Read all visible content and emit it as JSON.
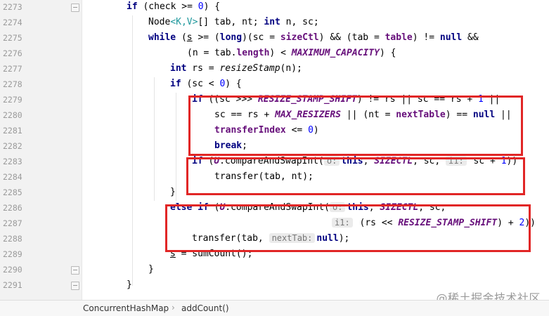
{
  "line_numbers": [
    "2273",
    "2274",
    "2275",
    "2276",
    "2277",
    "2278",
    "2279",
    "2280",
    "2281",
    "2282",
    "2283",
    "2284",
    "2285",
    "2286",
    "2287",
    "2288",
    "2289",
    "2290",
    "2291"
  ],
  "code": {
    "l2273": {
      "kw_if": "if",
      "rest": " (check >= ",
      "zero": "0",
      "close": ") {"
    },
    "l2274": {
      "node": "Node",
      "generic": "<K,V>",
      "arr": "[] tab, nt; ",
      "kw_int": "int",
      "rest": " n, sc;"
    },
    "l2275": {
      "kw_while": "while",
      "p1": " (",
      "s": "s",
      "p2": " >= (",
      "kw_long": "long",
      "p3": ")(sc = ",
      "sizectl": "sizeCtl",
      "p4": ") && (tab = ",
      "table": "table",
      "p5": ") != ",
      "kw_null": "null",
      "p6": " &&"
    },
    "l2276": {
      "p1": "(n = tab.",
      "length": "length",
      "p2": ") < ",
      "maxcap": "MAXIMUM_CAPACITY",
      "p3": ") {"
    },
    "l2277": {
      "kw_int": "int",
      "p1": " rs = ",
      "fn": "resizeStamp",
      "p2": "(n);"
    },
    "l2278": {
      "kw_if": "if",
      "p1": " (sc < ",
      "zero": "0",
      "p2": ") {"
    },
    "l2279": {
      "kw_if": "if",
      "p1": " ((sc >>> ",
      "shift": "RESIZE_STAMP_SHIFT",
      "p2": ") != rs || sc == rs + ",
      "one": "1",
      "p3": " ||"
    },
    "l2280": {
      "p1": "sc == rs + ",
      "maxres": "MAX_RESIZERS",
      "p2": " || (nt = ",
      "nexttable": "nextTable",
      "p3": ") == ",
      "kw_null": "null",
      "p4": " ||"
    },
    "l2281": {
      "transferindex": "transferIndex",
      "p1": " <= ",
      "zero": "0",
      "p2": ")"
    },
    "l2282": {
      "kw_break": "break",
      "p1": ";"
    },
    "l2283": {
      "kw_if": "if",
      "p1": " (",
      "u": "U",
      "p2": ".compareAndSwapInt(",
      "hint_o": "o:",
      "kw_this": "this",
      "p3": ", ",
      "sizectl_c": "SIZECTL",
      "p4": ", sc, ",
      "hint_i1": "i1:",
      "p5": " sc + ",
      "one": "1",
      "p6": "))"
    },
    "l2284": {
      "p1": "transfer(tab, nt);"
    },
    "l2285": {
      "p1": "}"
    },
    "l2286": {
      "kw_else": "else",
      "sp": " ",
      "kw_if": "if",
      "p1": " (",
      "u": "U",
      "p2": ".compareAndSwapInt(",
      "hint_o": "o:",
      "kw_this": "this",
      "p3": ", ",
      "sizectl_c": "SIZECTL",
      "p4": ", sc,"
    },
    "l2287": {
      "hint_i1": "i1:",
      "p1": " (rs << ",
      "shift": "RESIZE_STAMP_SHIFT",
      "p2": ") + ",
      "two": "2",
      "p3": "))"
    },
    "l2288": {
      "p1": "transfer(tab, ",
      "hint_next": "nextTab:",
      "kw_null": "null",
      "p2": ");"
    },
    "l2289": {
      "s": "s",
      "p1": " = sumCount();"
    },
    "l2290": {
      "p1": "}"
    },
    "l2291": {
      "p1": "}"
    }
  },
  "breadcrumb": {
    "class_name": "ConcurrentHashMap",
    "separator": "›",
    "method_name": "addCount()"
  },
  "watermark": "@稀土掘金技术社区",
  "colors": {
    "keyword": "#000080",
    "field": "#660e7a",
    "number": "#0000ff",
    "highlight_box": "#e12626",
    "gutter": "#f2f2f2"
  }
}
